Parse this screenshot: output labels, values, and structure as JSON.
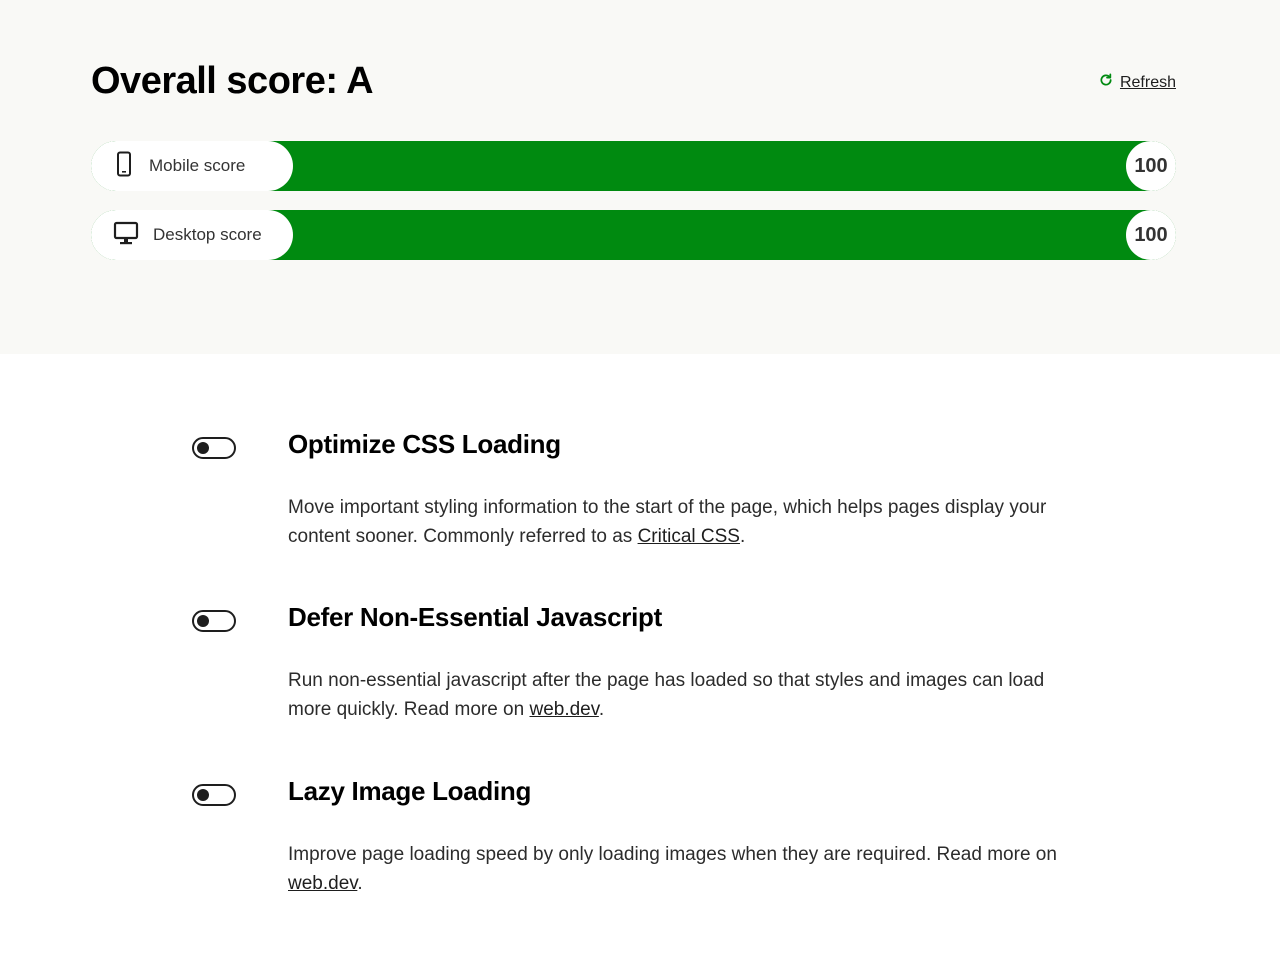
{
  "header": {
    "title": "Overall score: A",
    "refresh_label": "Refresh"
  },
  "scores": [
    {
      "label": "Mobile score",
      "value": "100",
      "icon": "mobile-phone-icon",
      "progress_percent": 100
    },
    {
      "label": "Desktop score",
      "value": "100",
      "icon": "desktop-monitor-icon",
      "progress_percent": 100
    }
  ],
  "features": [
    {
      "title": "Optimize CSS Loading",
      "desc_before": "Move important styling information to the start of the page, which helps pages display your content sooner. Commonly referred to as ",
      "link": "Critical CSS",
      "desc_after": ".",
      "enabled": false
    },
    {
      "title": "Defer Non-Essential Javascript",
      "desc_before": "Run non-essential javascript after the page has loaded so that styles and images can load more quickly. Read more on ",
      "link": "web.dev",
      "desc_after": ".",
      "enabled": false
    },
    {
      "title": "Lazy Image Loading",
      "desc_before": "Improve page loading speed by only loading images when they are required. Read more on ",
      "link": "web.dev",
      "desc_after": ".",
      "enabled": false
    }
  ],
  "colors": {
    "score_bar": "#008a10",
    "refresh_icon": "#008a10",
    "top_background": "#f9f9f6"
  }
}
